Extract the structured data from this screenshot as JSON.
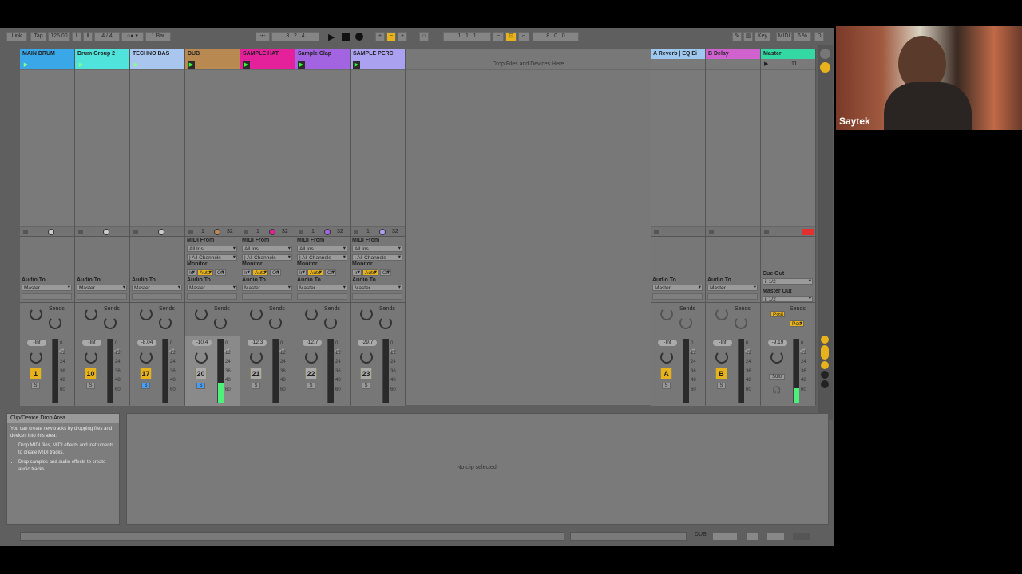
{
  "transport": {
    "link": "Link",
    "tap": "Tap",
    "tempo": "125.00",
    "signature": "4 / 4",
    "quantize": "1 Bar",
    "position": "3 . 2 . 4",
    "loop_start": "1 . 1 . 1",
    "loop_length": "8 . 0 . 0",
    "key": "Key",
    "midi": "MIDI",
    "cpu": "6 %",
    "d": "D"
  },
  "drop_area_label": "Drop Files and Devices Here",
  "io_labels": {
    "midi_from": "MIDI From",
    "all_ins": "All Ins",
    "all_channels": "| All Channels",
    "monitor": "Monitor",
    "in": "In",
    "auto": "Auto",
    "off": "Off",
    "audio_to": "Audio To",
    "master": "Master",
    "sends": "Sends",
    "cue_out": "Cue Out",
    "master_out": "Master Out",
    "out_value": "ii 1/2",
    "post": "Post",
    "solo": "Solo",
    "s": "S"
  },
  "meter_scale": [
    "0",
    "12",
    "24",
    "36",
    "48",
    "60"
  ],
  "tracks": [
    {
      "name": "MAIN DRUM",
      "color": "#3aa8e8",
      "number": "1",
      "volume": "-Inf",
      "midi": false,
      "active": true,
      "solo_on": false
    },
    {
      "name": "Drum Group 2",
      "color": "#4fe3dc",
      "number": "10",
      "volume": "-Inf",
      "midi": false,
      "active": true,
      "solo_on": false
    },
    {
      "name": "TECHNO BAS",
      "color": "#a9c6ee",
      "number": "17",
      "volume": "-8.04",
      "midi": false,
      "active": true,
      "solo_on": true
    },
    {
      "name": "DUB",
      "color": "#b88a52",
      "number": "20",
      "volume": "-10.4",
      "midi": true,
      "active": false,
      "solo_on": true,
      "slot_num": "1",
      "slot_end": "32"
    },
    {
      "name": "SAMPLE HAT",
      "color": "#e4209a",
      "number": "21",
      "volume": "-12.3",
      "midi": true,
      "active": false,
      "solo_on": false,
      "slot_num": "1",
      "slot_end": "32"
    },
    {
      "name": "Sample Clap",
      "color": "#a264e0",
      "number": "22",
      "volume": "-12.7",
      "midi": true,
      "active": false,
      "solo_on": false,
      "slot_num": "1",
      "slot_end": "32"
    },
    {
      "name": "SAMPLE PERC",
      "color": "#aaa2f0",
      "number": "23",
      "volume": "-29.7",
      "midi": true,
      "active": false,
      "solo_on": false,
      "slot_num": "1",
      "slot_end": "32"
    }
  ],
  "returns": [
    {
      "name": "A Reverb | EQ Ei",
      "color": "#9ec8f0",
      "letter": "A",
      "volume": "-Inf"
    },
    {
      "name": "B Delay",
      "color": "#d062d0",
      "letter": "B",
      "volume": "-Inf"
    }
  ],
  "master": {
    "name": "Master",
    "color": "#34d8a2",
    "scene": "11",
    "volume": "-9.19"
  },
  "info": {
    "title": "Clip/Device Drop Area",
    "text": "You can create new tracks by dropping files and devices into this area:",
    "bullets": [
      "Drop MIDI files, MIDI effects and instruments to create MIDI tracks.",
      "Drop samples and audio effects to create audio tracks."
    ]
  },
  "detail": {
    "empty": "No clip selected."
  },
  "status": {
    "track": "DUB"
  },
  "webcam": {
    "name": "Saytek"
  }
}
